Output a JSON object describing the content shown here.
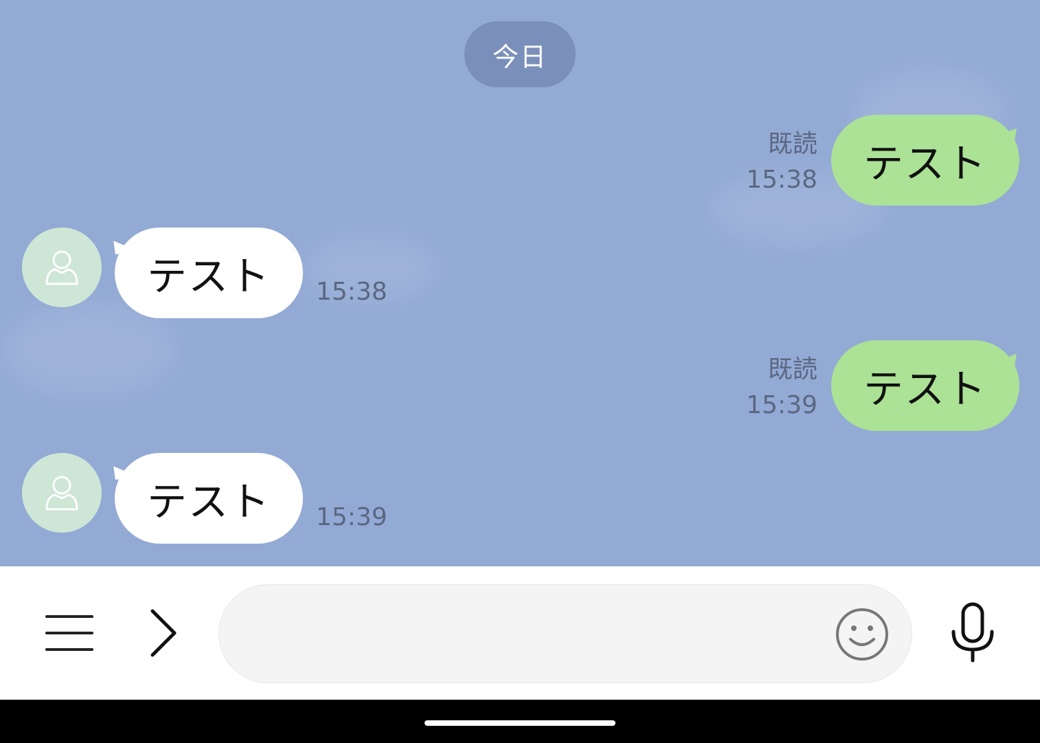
{
  "date_divider": "今日",
  "messages": [
    {
      "side": "sent",
      "text": "テスト",
      "read": "既読",
      "time": "15:38"
    },
    {
      "side": "received",
      "text": "テスト",
      "time": "15:38"
    },
    {
      "side": "sent",
      "text": "テスト",
      "read": "既読",
      "time": "15:39"
    },
    {
      "side": "received",
      "text": "テスト",
      "time": "15:39"
    }
  ],
  "input": {
    "value": "",
    "placeholder": ""
  },
  "icons": {
    "menu": "menu-icon",
    "expand": "chevron-right-icon",
    "emoji": "emoji-icon",
    "mic": "mic-icon",
    "avatar": "person-icon"
  },
  "colors": {
    "chat_background": "#93aad5",
    "sent_bubble": "#abe296",
    "received_bubble": "#ffffff",
    "avatar_background": "#cde6d6",
    "date_pill": "#7a90ba"
  }
}
